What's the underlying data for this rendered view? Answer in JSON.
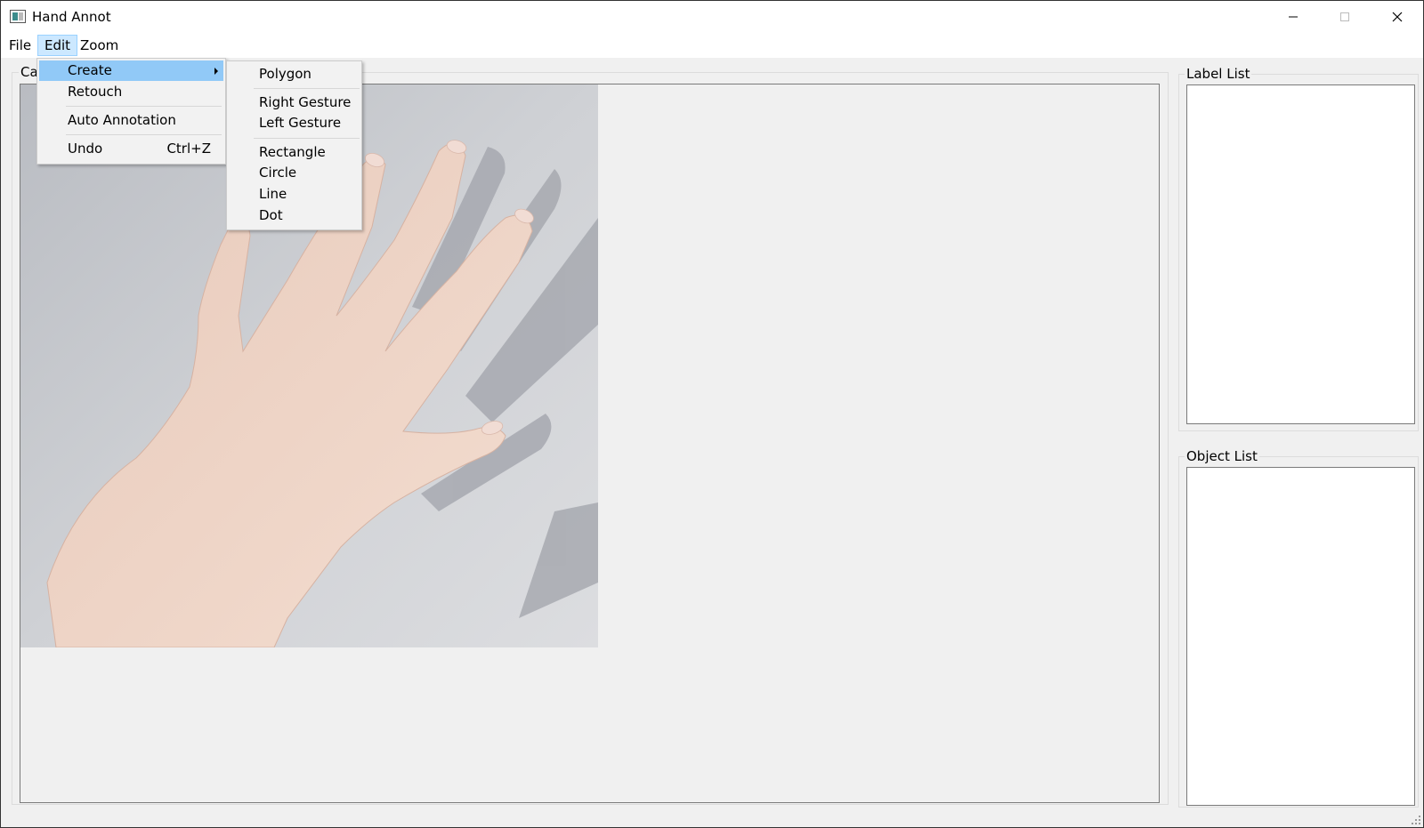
{
  "window": {
    "title": "Hand Annot",
    "minimize_icon": "minimize-icon",
    "maximize_icon": "maximize-icon",
    "close_icon": "close-icon"
  },
  "menubar": {
    "items": [
      {
        "label": "File"
      },
      {
        "label": "Edit",
        "active": true
      },
      {
        "label": "Zoom"
      }
    ]
  },
  "edit_menu": {
    "items": [
      {
        "label": "Create",
        "highlighted": true,
        "has_submenu": true
      },
      {
        "label": "Retouch"
      },
      {
        "label": "Auto Annotation"
      },
      {
        "label": "Undo",
        "shortcut": "Ctrl+Z"
      }
    ]
  },
  "create_submenu": {
    "items": [
      {
        "label": "Polygon"
      },
      {
        "label": "Right Gesture"
      },
      {
        "label": "Left Gesture"
      },
      {
        "label": "Rectangle"
      },
      {
        "label": "Circle"
      },
      {
        "label": "Line"
      },
      {
        "label": "Dot"
      }
    ]
  },
  "canvas": {
    "title": "Ca",
    "image": "hand-photo"
  },
  "panels": {
    "label_list_title": "Label List",
    "object_list_title": "Object List"
  },
  "colors": {
    "menu_highlight": "#91c9f7",
    "menubar_active": "#cce8ff",
    "window_bg": "#f0f0f0"
  }
}
